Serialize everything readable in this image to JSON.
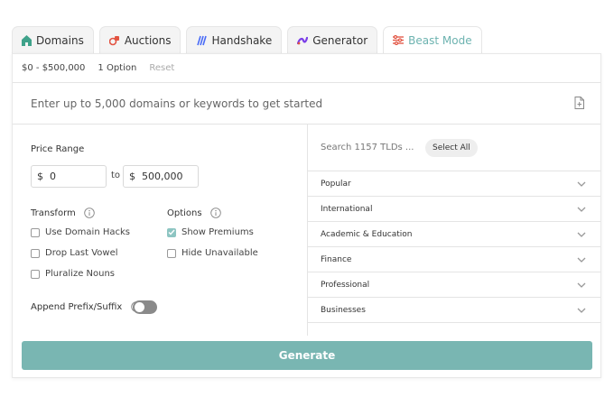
{
  "tabs": [
    {
      "label": "Domains",
      "icon": "leaf-icon",
      "color": "#3fa28a"
    },
    {
      "label": "Auctions",
      "icon": "gavel-icon",
      "color": "#e25341"
    },
    {
      "label": "Handshake",
      "icon": "handshake-logo-icon",
      "color": "#4a6cf7"
    },
    {
      "label": "Generator",
      "icon": "generator-logo-icon",
      "color": "#7a3ee8"
    },
    {
      "label": "Beast Mode",
      "icon": "sliders-icon",
      "color": "#e25341",
      "active": true
    }
  ],
  "summary": {
    "price": "$0 - $500,000",
    "options": "1 Option",
    "reset": "Reset"
  },
  "domain_input": {
    "placeholder": "Enter up to 5,000 domains or keywords to get started",
    "value": ""
  },
  "price_range": {
    "label": "Price Range",
    "currency": "$",
    "min": "0",
    "to": "to",
    "max": "500,000"
  },
  "transform": {
    "label": "Transform",
    "items": [
      {
        "label": "Use Domain Hacks",
        "checked": false
      },
      {
        "label": "Drop Last Vowel",
        "checked": false
      },
      {
        "label": "Pluralize Nouns",
        "checked": false
      }
    ]
  },
  "options": {
    "label": "Options",
    "items": [
      {
        "label": "Show Premiums",
        "checked": true
      },
      {
        "label": "Hide Unavailable",
        "checked": false
      }
    ]
  },
  "append": {
    "label": "Append Prefix/Suffix",
    "enabled": false
  },
  "tld": {
    "search_placeholder": "Search 1157 TLDs ...",
    "select_all": "Select All",
    "categories": [
      "Popular",
      "International",
      "Academic & Education",
      "Finance",
      "Professional",
      "Businesses"
    ]
  },
  "generate_label": "Generate",
  "colors": {
    "accent": "#79b6b2",
    "active_tab_text": "#6db3b0"
  }
}
